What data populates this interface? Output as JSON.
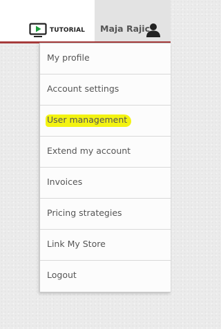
{
  "header": {
    "tutorial_label": "TUTORIAL",
    "tutorial_icon": "tv-play-icon",
    "user_name": "Maja Rajic",
    "user_icon": "user-silhouette-icon",
    "accent_color": "#a63a3a",
    "tutorial_icon_color": "#1d9d3c"
  },
  "menu": {
    "items": [
      {
        "label": "My profile"
      },
      {
        "label": "Account settings"
      },
      {
        "label": "User management",
        "highlighted": true
      },
      {
        "label": "Extend my account"
      },
      {
        "label": "Invoices"
      },
      {
        "label": "Pricing strategies"
      },
      {
        "label": "Link My Store"
      },
      {
        "label": "Logout"
      }
    ],
    "highlight_color": "#f3f312"
  }
}
